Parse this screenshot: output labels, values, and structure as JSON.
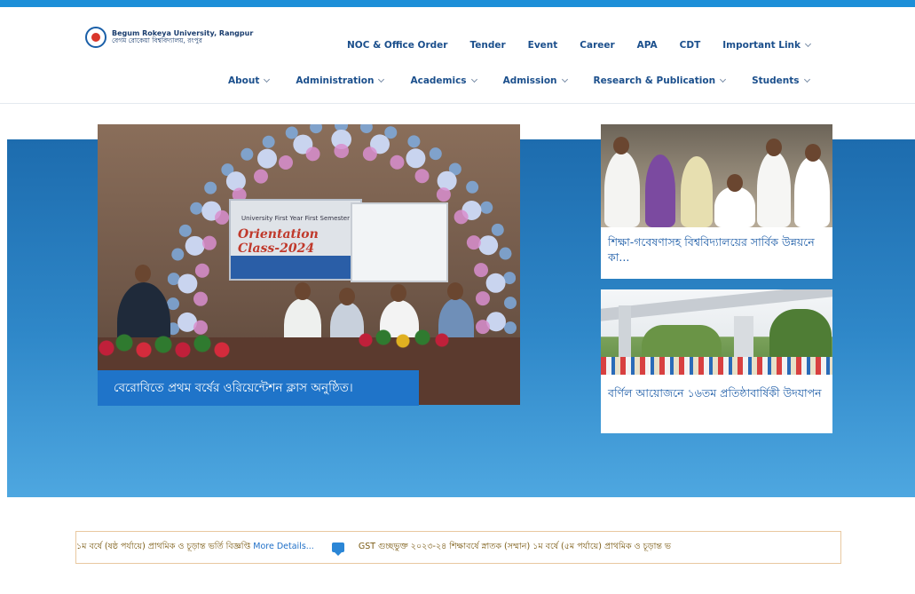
{
  "site": {
    "name_en": "Begum Rokeya University, Rangpur",
    "name_bn": "বেগম রোকেয়া বিশ্ববিদ্যালয়, রংপুর"
  },
  "nav_top": [
    {
      "label": "NOC & Office Order"
    },
    {
      "label": "Tender"
    },
    {
      "label": "Event"
    },
    {
      "label": "Career"
    },
    {
      "label": "APA"
    },
    {
      "label": "CDT"
    },
    {
      "label": "Important Link"
    }
  ],
  "nav_main": [
    {
      "label": "About"
    },
    {
      "label": "Administration"
    },
    {
      "label": "Academics"
    },
    {
      "label": "Admission"
    },
    {
      "label": "Research & Publication"
    },
    {
      "label": "Students"
    }
  ],
  "hero": {
    "main": {
      "caption": "বেরোবিতে প্রথম বর্ষের ওরিয়েন্টেশন ক্লাস অনুষ্ঠিত।",
      "banner_line1": "University First Year First Semester",
      "banner_line2": "Orientation Class-2024"
    },
    "cards": [
      {
        "title": "শিক্ষা-গবেষণাসহ বিশ্ববিদ্যালয়ের সার্বিক উন্নয়নে কা..."
      },
      {
        "title": "বর্ণিল আয়োজনে ১৬তম প্রতিষ্ঠাবার্ষিকী উদযাপন"
      }
    ]
  },
  "ticker": {
    "item1_text": "১ম বর্ষে (ষষ্ঠ পর্যায়ে) প্রাথমিক ও চূড়ান্ত ভর্তি বিজ্ঞপ্তি",
    "more_label": "More Details...",
    "item2_text": "GST গুচ্ছভুক্ত ২০২৩-২৪ শিক্ষাবর্ষে স্নাতক (সম্মান) ১ম বর্ষে (৫ম পর্যায়ে) প্রাথমিক ও চূড়ান্ত ভ"
  },
  "colors": {
    "top_stripe": "#1d8fd8",
    "nav_text": "#1b4f8c",
    "hero_band": "#2f88c9",
    "caption_bg": "#1f74c9",
    "card_title": "#1f5ea8",
    "ticker_border": "#e9c8a0"
  }
}
